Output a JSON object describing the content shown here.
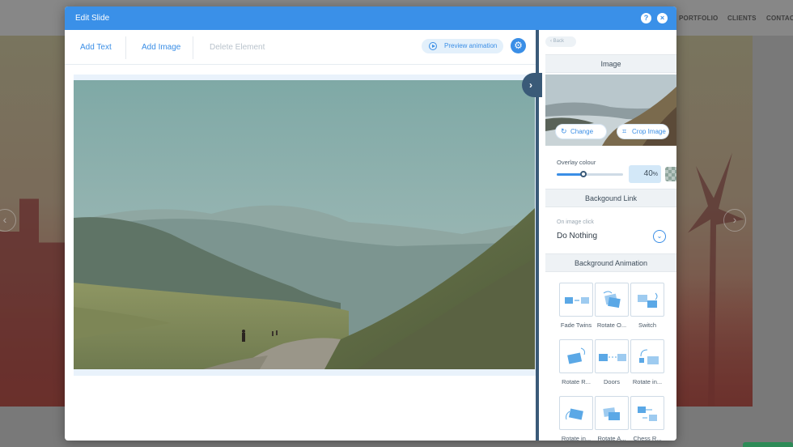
{
  "background_site": {
    "nav": [
      "PORTFOLIO",
      "CLIENTS",
      "CONTAC"
    ]
  },
  "modal": {
    "title": "Edit Slide",
    "help_icon": "?",
    "close_icon": "×"
  },
  "toolbar": {
    "add_text": "Add Text",
    "add_image": "Add Image",
    "delete_element": "Delete Element",
    "preview": "Preview animation",
    "settings_icon": "⚙"
  },
  "panel": {
    "back": "‹ Back",
    "image_section": {
      "title": "Image",
      "change": "Change",
      "crop": "Crop Image"
    },
    "overlay": {
      "label": "Overlay colour",
      "value": "40",
      "unit": "%",
      "level": 0.4
    },
    "link_section": {
      "title": "Backgound Link",
      "on_click_label": "On image click",
      "selected": "Do Nothing"
    },
    "animation_section": {
      "title": "Background Animation",
      "items": [
        {
          "label": "Fade Twins",
          "icon": "fade-twins-icon"
        },
        {
          "label": "Rotate O...",
          "icon": "rotate-out-icon"
        },
        {
          "label": "Switch",
          "icon": "switch-icon"
        },
        {
          "label": "Rotate R...",
          "icon": "rotate-right-icon"
        },
        {
          "label": "Doors",
          "icon": "doors-icon"
        },
        {
          "label": "Rotate in...",
          "icon": "rotate-in-icon"
        },
        {
          "label": "Rotate in...",
          "icon": "rotate-in-2-icon"
        },
        {
          "label": "Rotate A...",
          "icon": "rotate-a-icon"
        },
        {
          "label": "Chess R...",
          "icon": "chess-r-icon"
        }
      ]
    }
  },
  "colors": {
    "accent": "#3a8ee6",
    "header": "#3a90e8",
    "divider": "#3a5a78"
  }
}
